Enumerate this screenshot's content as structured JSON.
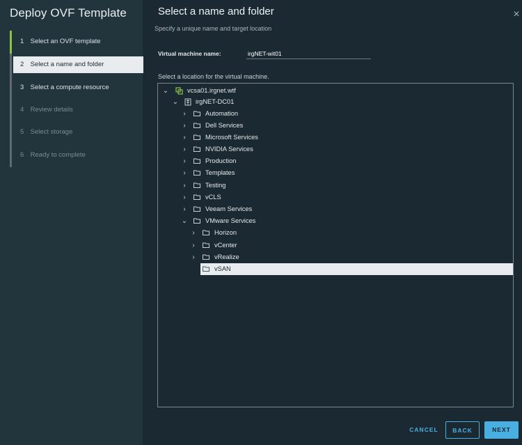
{
  "sidebar": {
    "title": "Deploy OVF Template",
    "steps": [
      {
        "num": "1",
        "label": "Select an OVF template"
      },
      {
        "num": "2",
        "label": "Select a name and folder"
      },
      {
        "num": "3",
        "label": "Select a compute resource"
      },
      {
        "num": "4",
        "label": "Review details"
      },
      {
        "num": "5",
        "label": "Select storage"
      },
      {
        "num": "6",
        "label": "Ready to complete"
      }
    ]
  },
  "main": {
    "title": "Select a name and folder",
    "subtitle": "Specify a unique name and target location",
    "vm_name_label": "Virtual machine name:",
    "vm_name_value": "irgNET-wit01",
    "location_label": "Select a location for the virtual machine.",
    "close_glyph": "×"
  },
  "tree": [
    {
      "label": "vcsa01.irgnet.wtf",
      "chevron": "⌄",
      "icon": "vcenter-icon"
    },
    {
      "label": "irgNET-DC01",
      "chevron": "⌄",
      "icon": "datacenter-icon"
    },
    {
      "label": "Automation",
      "chevron": "›",
      "icon": "folder-icon"
    },
    {
      "label": "Dell Services",
      "chevron": "›",
      "icon": "folder-icon"
    },
    {
      "label": "Microsoft Services",
      "chevron": "›",
      "icon": "folder-icon"
    },
    {
      "label": "NVIDIA Services",
      "chevron": "›",
      "icon": "folder-icon"
    },
    {
      "label": "Production",
      "chevron": "›",
      "icon": "folder-icon"
    },
    {
      "label": "Templates",
      "chevron": "›",
      "icon": "folder-icon"
    },
    {
      "label": "Testing",
      "chevron": "›",
      "icon": "folder-icon"
    },
    {
      "label": "vCLS",
      "chevron": "›",
      "icon": "folder-icon"
    },
    {
      "label": "Veeam Services",
      "chevron": "›",
      "icon": "folder-icon"
    },
    {
      "label": "VMware Services",
      "chevron": "⌄",
      "icon": "folder-icon"
    },
    {
      "label": "Horizon",
      "chevron": "›",
      "icon": "folder-icon"
    },
    {
      "label": "vCenter",
      "chevron": "›",
      "icon": "folder-icon"
    },
    {
      "label": "vRealize",
      "chevron": "›",
      "icon": "folder-icon"
    },
    {
      "label": "vSAN",
      "chevron": "",
      "icon": "folder-icon",
      "selected": true
    }
  ],
  "buttons": {
    "cancel": "CANCEL",
    "back": "BACK",
    "next": "NEXT"
  },
  "colors": {
    "accent": "#49aee0",
    "progress": "#8bc34a",
    "sidebar_bg": "#22343c",
    "main_bg": "#1b2a32"
  }
}
